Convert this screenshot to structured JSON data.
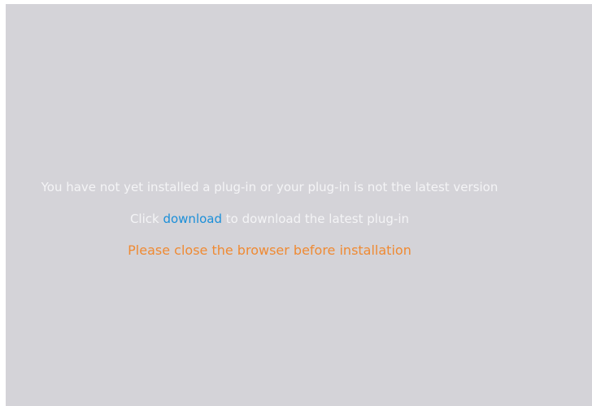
{
  "plugin_prompt": {
    "not_installed_text": "You have not yet installed a plug-in or your plug-in is not the latest version",
    "click_prefix": "Click ",
    "download_link": "download",
    "click_suffix": " to download the latest plug-in",
    "warning_text": "Please close the browser before installation"
  },
  "colors": {
    "background": "#d4d3d8",
    "message_text": "#f4f4f6",
    "link": "#1b8fd9",
    "warning": "#ef8a33"
  }
}
